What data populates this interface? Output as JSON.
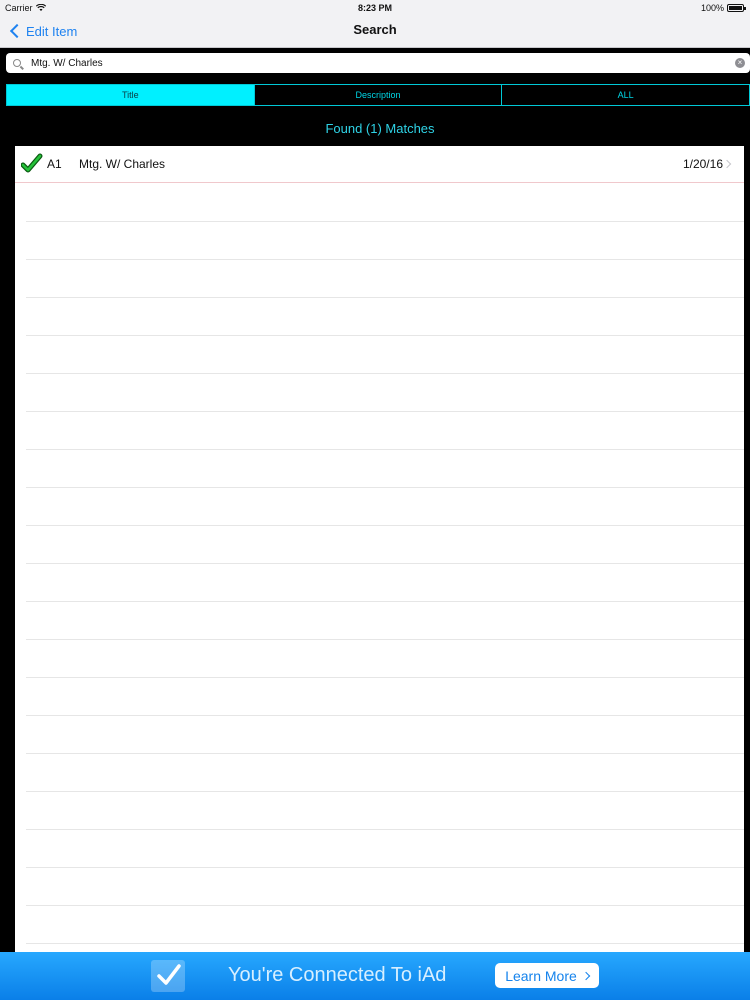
{
  "status_bar": {
    "carrier": "Carrier",
    "time": "8:23 PM",
    "battery": "100%"
  },
  "nav": {
    "back_label": "Edit Item",
    "title": "Search"
  },
  "search": {
    "value": "Mtg. W/ Charles",
    "placeholder": ""
  },
  "segments": [
    {
      "label": "Title",
      "active": true
    },
    {
      "label": "Description",
      "active": false
    },
    {
      "label": "ALL",
      "active": false
    }
  ],
  "results_text": "Found (1) Matches",
  "rows": [
    {
      "code": "A1",
      "title": "Mtg. W/ Charles",
      "date": "1/20/16"
    }
  ],
  "ad": {
    "text": "You're Connected To iAd",
    "button": "Learn More"
  },
  "colors": {
    "accent": "#00f0ff",
    "link": "#1e82f0"
  }
}
